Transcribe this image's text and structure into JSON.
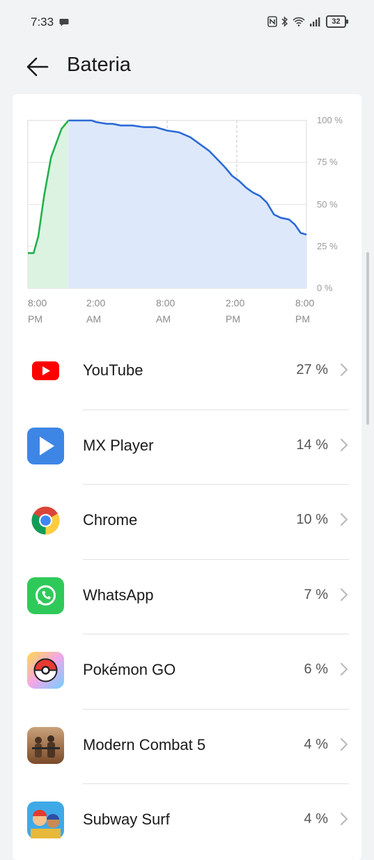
{
  "status": {
    "time": "7:33",
    "battery": "32"
  },
  "header": {
    "title": "Bateria"
  },
  "chart_data": {
    "type": "line",
    "x_ticks": [
      "8:00\nPM",
      "2:00\nAM",
      "8:00\nAM",
      "2:00\nPM",
      "8:00\nPM"
    ],
    "y_ticks": [
      "100 %",
      "75 %",
      "50 %",
      "25 %",
      "0 %"
    ],
    "ylim": [
      0,
      100
    ],
    "xlim": [
      0,
      24
    ],
    "grid": true,
    "series": [
      {
        "color": "#22b14c",
        "x": [
          0,
          0.5,
          0.9,
          1.4,
          2.0,
          2.9,
          3.5
        ],
        "y": [
          21,
          21,
          31,
          55,
          78,
          95,
          100
        ]
      },
      {
        "color": "#2a6ad6",
        "x": [
          3.5,
          4.3,
          5.5,
          5.9,
          6.8,
          7.3,
          8.0,
          8.4,
          9.0,
          10.0,
          11.0,
          12.0,
          13.0,
          14.0,
          14.4,
          15.0,
          15.6,
          16.3,
          17.0,
          17.6,
          18.2,
          18.8,
          19.4,
          20.0,
          20.6,
          21.2,
          21.8,
          22.5,
          23.0,
          23.5,
          24.0
        ],
        "y": [
          100,
          100,
          100,
          99,
          98,
          98,
          97,
          97,
          97,
          96,
          96,
          94,
          93,
          90,
          88,
          85,
          82,
          77,
          72,
          67,
          64,
          60,
          57,
          55,
          51,
          44,
          42,
          41,
          38,
          33,
          32
        ]
      }
    ]
  },
  "apps": [
    {
      "name": "YouTube",
      "percent": "27 %",
      "icon": "youtube-icon"
    },
    {
      "name": "MX Player",
      "percent": "14 %",
      "icon": "mx-player-icon"
    },
    {
      "name": "Chrome",
      "percent": "10 %",
      "icon": "chrome-icon"
    },
    {
      "name": "WhatsApp",
      "percent": "7 %",
      "icon": "whatsapp-icon"
    },
    {
      "name": "Pokémon GO",
      "percent": "6 %",
      "icon": "pokemon-go-icon"
    },
    {
      "name": "Modern Combat 5",
      "percent": "4 %",
      "icon": "modern-combat-icon"
    },
    {
      "name": "Subway Surf",
      "percent": "4 %",
      "icon": "subway-surf-icon"
    }
  ],
  "colors": {
    "accent": "#2a6ad6",
    "charge": "#22b14c",
    "fill": "#dce8fc"
  }
}
